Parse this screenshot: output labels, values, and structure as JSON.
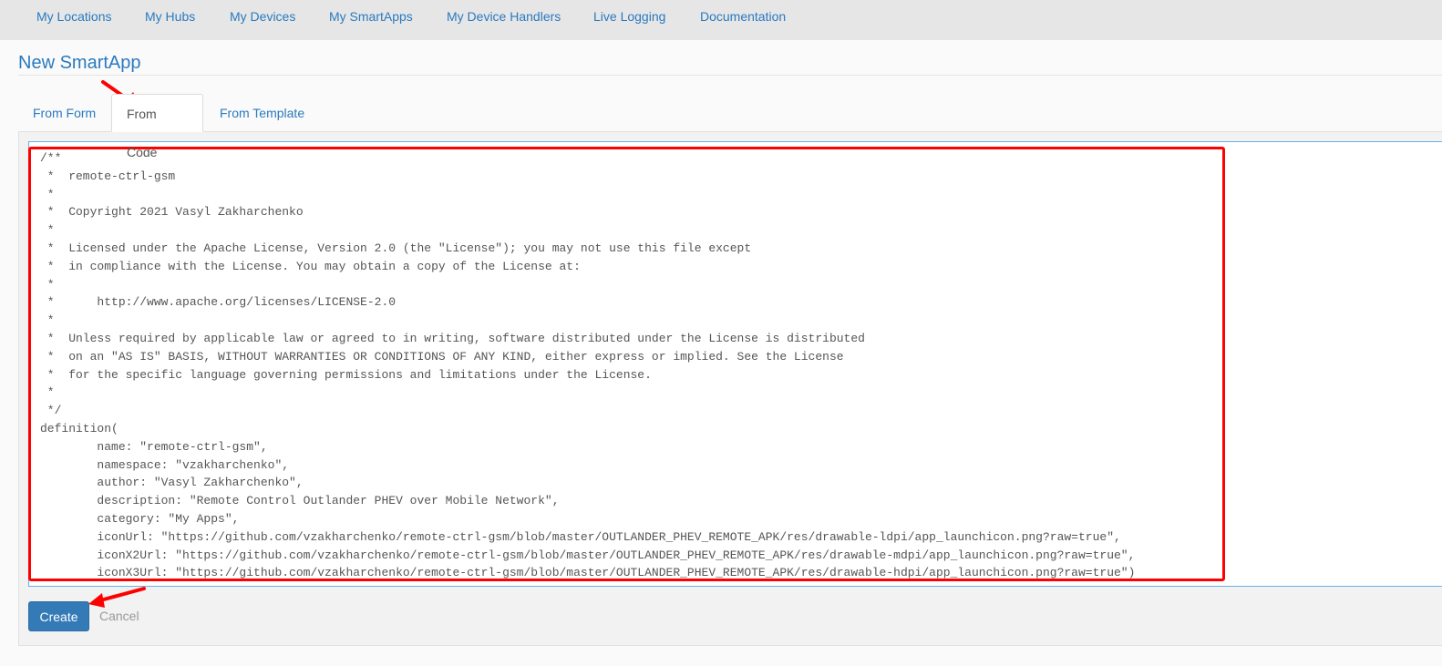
{
  "topnav": {
    "links": [
      "My Locations",
      "My Hubs",
      "My Devices",
      "My SmartApps",
      "My Device Handlers",
      "Live Logging",
      "Documentation"
    ]
  },
  "page": {
    "title": "New SmartApp"
  },
  "tabs": [
    "From Form",
    "From Code",
    "From Template"
  ],
  "active_tab": "From Code",
  "editor": {
    "code": "/**\n *  remote-ctrl-gsm\n *\n *  Copyright 2021 Vasyl Zakharchenko\n *\n *  Licensed under the Apache License, Version 2.0 (the \"License\"); you may not use this file except\n *  in compliance with the License. You may obtain a copy of the License at:\n *\n *      http://www.apache.org/licenses/LICENSE-2.0\n *\n *  Unless required by applicable law or agreed to in writing, software distributed under the License is distributed\n *  on an \"AS IS\" BASIS, WITHOUT WARRANTIES OR CONDITIONS OF ANY KIND, either express or implied. See the License\n *  for the specific language governing permissions and limitations under the License.\n *\n */\ndefinition(\n        name: \"remote-ctrl-gsm\",\n        namespace: \"vzakharchenko\",\n        author: \"Vasyl Zakharchenko\",\n        description: \"Remote Control Outlander PHEV over Mobile Network\",\n        category: \"My Apps\",\n        iconUrl: \"https://github.com/vzakharchenko/remote-ctrl-gsm/blob/master/OUTLANDER_PHEV_REMOTE_APK/res/drawable-ldpi/app_launchicon.png?raw=true\",\n        iconX2Url: \"https://github.com/vzakharchenko/remote-ctrl-gsm/blob/master/OUTLANDER_PHEV_REMOTE_APK/res/drawable-mdpi/app_launchicon.png?raw=true\",\n        iconX3Url: \"https://github.com/vzakharchenko/remote-ctrl-gsm/blob/master/OUTLANDER_PHEV_REMOTE_APK/res/drawable-hdpi/app_launchicon.png?raw=true\")"
  },
  "actions": {
    "create_label": "Create",
    "cancel_label": "Cancel"
  },
  "colors": {
    "link": "#2a7ac0",
    "primary_button": "#337ab7",
    "annotation": "#ff0000",
    "editor_focus": "#66afe9"
  },
  "icons": [
    "annotation-arrow-icon"
  ]
}
